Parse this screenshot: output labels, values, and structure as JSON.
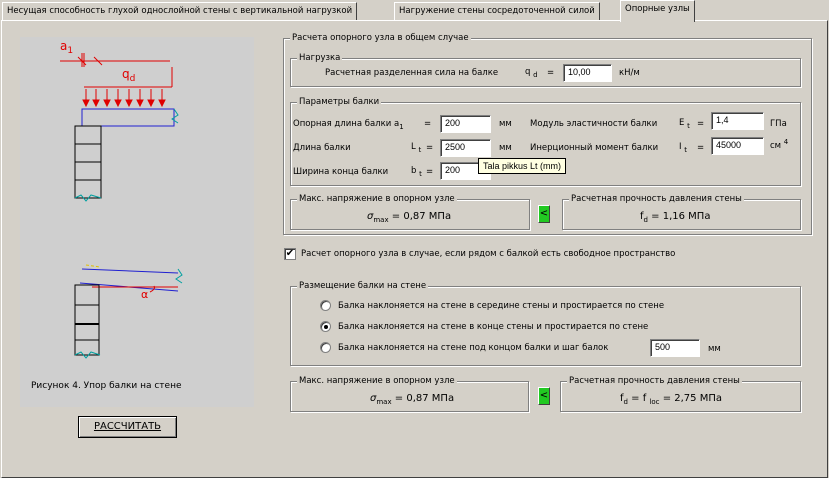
{
  "tabs": [
    "Несущая способность глухой однослойной стены с вертикальной нагрузкой",
    "Нагружение стены сосредоточенной силой",
    "Опорные узлы"
  ],
  "figure": {
    "caption": "Рисунок 4. Упор балки на стене",
    "a_label": "a",
    "a_sub": "1",
    "q_label": "q",
    "q_sub": "d",
    "alpha": "α"
  },
  "calculate_button": "РАССЧИТАТЬ",
  "general": {
    "title": "Расчета опорного узла в общем случае",
    "load": {
      "title": "Нагрузка",
      "label": "Расчетная разделенная сила на балке",
      "symbol": "q",
      "symbol_sub": "d",
      "eq": "=",
      "value": "10,00",
      "unit": "кН/м"
    },
    "beam": {
      "title": "Параметры балки",
      "support_length_label": "Опорная длина балки a",
      "support_length_sub": "1",
      "support_length_eq": "=",
      "support_length_value": "200",
      "support_length_unit": "мм",
      "length_label": "Длина балки",
      "length_symbol": "L",
      "length_sub": "t",
      "length_eq": "=",
      "length_value": "2500",
      "length_unit": "мм",
      "width_label": "Ширина конца балки",
      "width_symbol": "b",
      "width_sub": "t",
      "width_eq": "=",
      "width_value": "200",
      "modulus_label": "Модуль эластичности балки",
      "modulus_symbol": "E",
      "modulus_sub": "t",
      "modulus_eq": "=",
      "modulus_value": "1,4",
      "modulus_unit": "ГПа",
      "inertia_label": "Инерционный момент балки",
      "inertia_symbol": "I",
      "inertia_sub": "t",
      "inertia_eq": "=",
      "inertia_value": "45000",
      "inertia_unit": "см",
      "inertia_unit_sup": "4",
      "tooltip": "Tala pikkus Lt (mm)"
    },
    "max_stress": {
      "title": "Макс. напряжение в опорном узле",
      "symbol": "σ",
      "symbol_sub": "max",
      "value": "=  0,87 МПа"
    },
    "compare": "<",
    "strength": {
      "title": "Расчетная прочность давления стены",
      "symbol": "f",
      "symbol_sub": "d",
      "value": "= 1,16 МПа"
    }
  },
  "free_space": {
    "checkbox_label": "Расчет опорного узла в случае, если рядом с балкой есть свободное пространство",
    "checked_mark": "✔",
    "placement": {
      "title": "Размещение балки на стене",
      "options": [
        "Балка наклоняется на стене в середине стены и простирается по стене",
        "Балка наклоняется на стене в конце стены и простирается по стене",
        "Балка наклоняется на стене под концом балки и шаг балок"
      ],
      "selected_index": 1,
      "spacing_value": "500",
      "spacing_unit": "мм"
    },
    "max_stress": {
      "title": "Макс. напряжение в опорном узле",
      "symbol": "σ",
      "symbol_sub": "max",
      "value": "=  0,87 МПа"
    },
    "compare": "<",
    "strength": {
      "title": "Расчетная прочность давления стены",
      "symbol": "f",
      "symbol_sub": "d",
      "eq": "= f",
      "sub2": "loc",
      "value": "= 2,75 МПа"
    }
  }
}
